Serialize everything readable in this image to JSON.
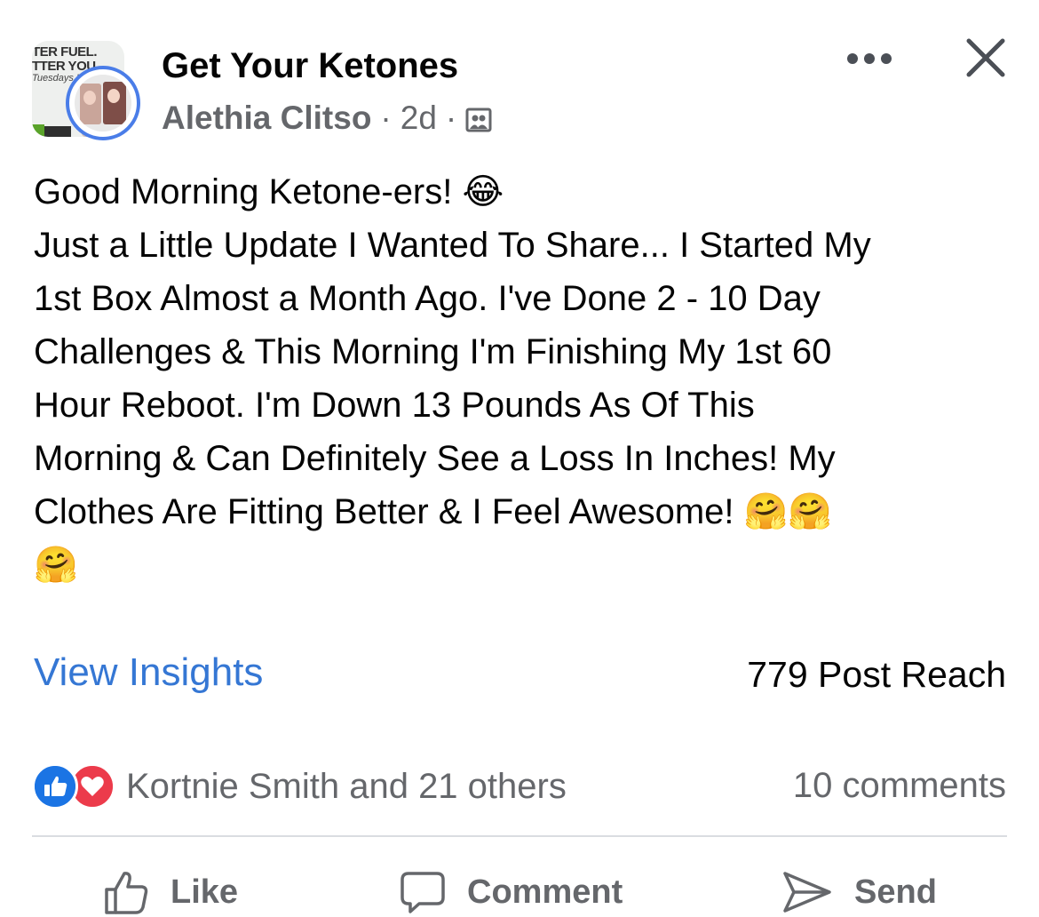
{
  "header": {
    "group_name": "Get Your Ketones",
    "author": "Alethia Clitso",
    "separator": "·",
    "time": "2d",
    "audience_icon": "group-photo-icon",
    "more_icon": "more-dots-icon",
    "close_icon": "close-icon",
    "group_thumb_text": [
      "TER FUEL.",
      "TTER YOU",
      "Tuesdays  Li"
    ]
  },
  "post": {
    "lines": [
      "Good Morning Ketone-ers! 😂",
      "Just a Little Update I Wanted To Share... I Started My",
      "1st Box Almost a Month Ago. I've Done 2 - 10 Day",
      "Challenges & This Morning I'm Finishing My 1st 60",
      "Hour Reboot. I'm Down 13 Pounds As Of This",
      "Morning & Can Definitely See a Loss In Inches! My",
      "Clothes Are Fitting Better & I Feel Awesome! 🤗🤗",
      "🤗"
    ]
  },
  "insights": {
    "link_label": "View Insights",
    "reach": "779 Post Reach"
  },
  "reactions": {
    "icons": [
      "like-reaction-icon",
      "love-reaction-icon"
    ],
    "text": "Kortnie Smith and 21 others",
    "comments": "10 comments"
  },
  "actions": {
    "like": "Like",
    "comment": "Comment",
    "send": "Send"
  },
  "colors": {
    "link_blue": "#3577d4",
    "like_blue": "#1b74e4",
    "love_red": "#ec3b4b",
    "secondary_text": "#65676b",
    "story_ring": "#4a7de8"
  }
}
